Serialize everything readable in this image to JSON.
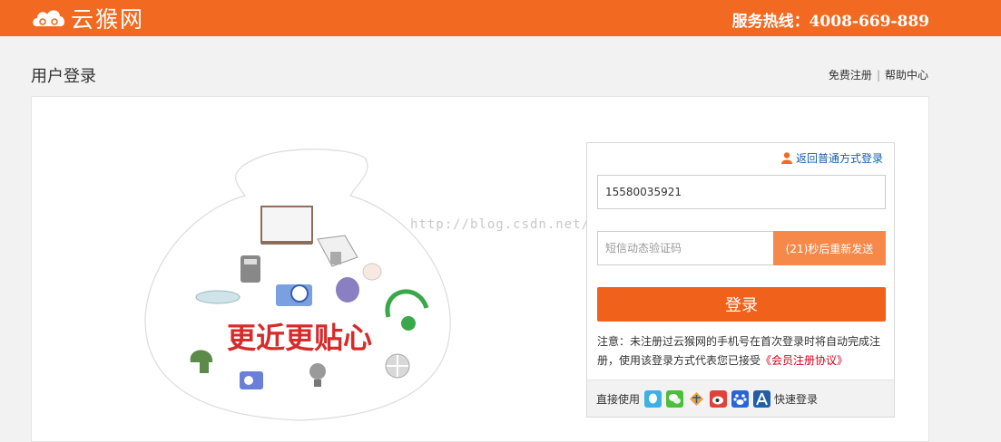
{
  "header": {
    "logo_text": "云猴网",
    "hotline": "服务热线：4008-669-889"
  },
  "page": {
    "title": "用户登录",
    "links": [
      "免费注册",
      "帮助中心"
    ]
  },
  "illustration": {
    "slogan": "更近更贴心"
  },
  "watermark": "http://blog.csdn.net/",
  "login": {
    "back_link": "返回普通方式登录",
    "phone_value": "15580035921",
    "sms_placeholder": "短信动态验证码",
    "resend_label": "(21)秒后重新发送",
    "submit_label": "登录",
    "notice_text": "注意：未注册过云猴网的手机号在首次登录时将自动完成注册，使用该登录方式代表您已接受",
    "agreement_link": "《会员注册协议》",
    "quick_prefix": "直接使用",
    "quick_suffix": "快速登录",
    "providers": [
      "qq-icon",
      "wechat-icon",
      "alipay-icon",
      "weibo-icon",
      "baidu-icon",
      "renren-icon"
    ]
  },
  "colors": {
    "brand": "#f26a21",
    "login_button": "#f0611b",
    "resend_button": "#f6894a",
    "link_blue": "#1a5ea8",
    "agreement_red": "#d0021b"
  }
}
